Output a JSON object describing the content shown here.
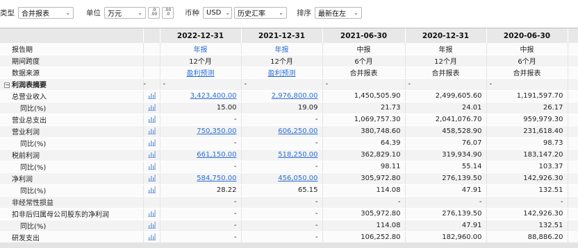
{
  "toolbar": {
    "type_label": "类型",
    "type_value": "合并报表",
    "unit_label": "单位",
    "unit_value": "万元",
    "currency_label": "币种",
    "currency_value": "USD",
    "rate_value": "历史汇率",
    "sort_label": "排序",
    "sort_value": "最新在左"
  },
  "columns": [
    "2022-12-31",
    "2021-12-31",
    "2021-06-30",
    "2020-12-31",
    "2020-06-30"
  ],
  "meta_rows": [
    {
      "label": "报告期",
      "values": [
        "年报",
        "年报",
        "中报",
        "年报",
        "中报"
      ],
      "style": [
        "link",
        "link",
        "plain",
        "plain",
        "plain"
      ]
    },
    {
      "label": "期间跨度",
      "values": [
        "12个月",
        "12个月",
        "6个月",
        "12个月",
        "6个月"
      ],
      "style": [
        "plain",
        "plain",
        "plain",
        "plain",
        "plain"
      ]
    },
    {
      "label": "数据来源",
      "values": [
        "盈利预测",
        "盈利预测",
        "合并报表",
        "合并报表",
        "合并报表"
      ],
      "style": [
        "ulink",
        "ulink",
        "plain",
        "plain",
        "plain"
      ]
    }
  ],
  "section": {
    "label": "利润表摘要",
    "toggle": "−",
    "values": [
      "-",
      "-",
      "-",
      "-",
      "-"
    ]
  },
  "rows": [
    {
      "label": "总营业收入",
      "indent": 1,
      "chart": true,
      "values": [
        "3,423,400.00",
        "2,976,800.00",
        "1,450,505.90",
        "2,499,605.60",
        "1,191,597.70"
      ],
      "style": [
        "ulink",
        "ulink",
        "plain",
        "plain",
        "plain"
      ]
    },
    {
      "label": "同比(%)",
      "indent": 2,
      "chart": true,
      "values": [
        "15.00",
        "19.09",
        "21.73",
        "24.01",
        "26.17"
      ],
      "style": [
        "plain",
        "plain",
        "plain",
        "plain",
        "plain"
      ]
    },
    {
      "label": "营业总支出",
      "indent": 1,
      "chart": true,
      "values": [
        "-",
        "-",
        "1,069,757.30",
        "2,041,076.70",
        "959,979.30"
      ],
      "style": [
        "plain",
        "plain",
        "plain",
        "plain",
        "plain"
      ]
    },
    {
      "label": "营业利润",
      "indent": 1,
      "chart": true,
      "values": [
        "750,350.00",
        "606,250.00",
        "380,748.60",
        "458,528.90",
        "231,618.40"
      ],
      "style": [
        "ulink",
        "ulink",
        "plain",
        "plain",
        "plain"
      ]
    },
    {
      "label": "同比(%)",
      "indent": 2,
      "chart": true,
      "values": [
        "-",
        "-",
        "64.39",
        "76.07",
        "98.73"
      ],
      "style": [
        "plain",
        "plain",
        "plain",
        "plain",
        "plain"
      ]
    },
    {
      "label": "税前利润",
      "indent": 1,
      "chart": true,
      "values": [
        "661,150.00",
        "518,250.00",
        "362,829.10",
        "319,934.90",
        "183,147.20"
      ],
      "style": [
        "ulink",
        "ulink",
        "plain",
        "plain",
        "plain"
      ]
    },
    {
      "label": "同比(%)",
      "indent": 2,
      "chart": true,
      "values": [
        "-",
        "-",
        "98.11",
        "55.14",
        "103.37"
      ],
      "style": [
        "plain",
        "plain",
        "plain",
        "plain",
        "plain"
      ]
    },
    {
      "label": "净利润",
      "indent": 1,
      "chart": true,
      "values": [
        "584,750.00",
        "456,050.00",
        "305,972.80",
        "276,139.50",
        "142,926.30"
      ],
      "style": [
        "ulink",
        "ulink",
        "plain",
        "plain",
        "plain"
      ]
    },
    {
      "label": "同比(%)",
      "indent": 2,
      "chart": true,
      "values": [
        "28.22",
        "65.15",
        "114.08",
        "47.91",
        "132.51"
      ],
      "style": [
        "plain",
        "plain",
        "plain",
        "plain",
        "plain"
      ]
    },
    {
      "label": "非经常性损益",
      "indent": 1,
      "chart": false,
      "values": [
        "-",
        "-",
        "-",
        "-",
        "-"
      ],
      "style": [
        "plain",
        "plain",
        "plain",
        "plain",
        "plain"
      ]
    },
    {
      "label": "扣非后归属母公司股东的净利润",
      "indent": 1,
      "chart": true,
      "values": [
        "-",
        "-",
        "305,972.80",
        "276,139.50",
        "142,926.30"
      ],
      "style": [
        "plain",
        "plain",
        "plain",
        "plain",
        "plain"
      ]
    },
    {
      "label": "同比(%)",
      "indent": 2,
      "chart": true,
      "values": [
        "-",
        "-",
        "114.08",
        "47.91",
        "132.51"
      ],
      "style": [
        "plain",
        "plain",
        "plain",
        "plain",
        "plain"
      ]
    },
    {
      "label": "研发支出",
      "indent": 1,
      "chart": true,
      "values": [
        "-",
        "-",
        "106,252.80",
        "182,960.00",
        "88,886.20"
      ],
      "style": [
        "plain",
        "plain",
        "plain",
        "plain",
        "plain"
      ]
    }
  ],
  "icons": {
    "chevron": "chevron-down-icon",
    "chart": "bar-chart-icon",
    "decimal_increase": "decimal-increase-icon",
    "decimal_decrease": "decimal-decrease-icon"
  },
  "colors": {
    "link": "#2a6fd6",
    "chart_icon": "#7fa6de",
    "header_bg": "#e8e8e8"
  }
}
